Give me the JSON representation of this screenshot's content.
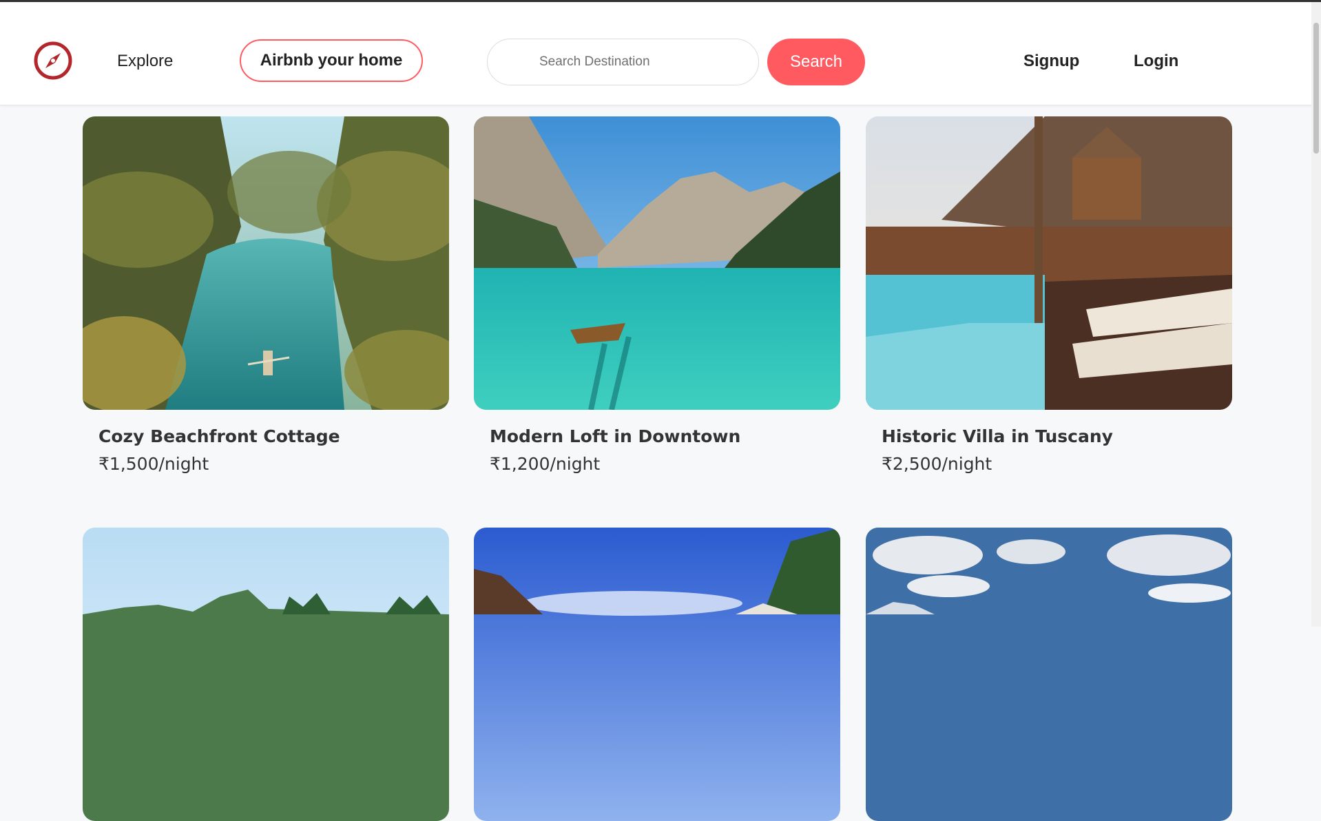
{
  "nav": {
    "explore_label": "Explore",
    "host_button_label": "Airbnb your home",
    "search_placeholder": "Search Destination",
    "search_value": "",
    "search_button_label": "Search",
    "signup_label": "Signup",
    "login_label": "Login",
    "logo_icon": "compass-icon",
    "accent_color": "#ff5a5f"
  },
  "listings": [
    {
      "title": "Cozy Beachfront Cottage",
      "price": "₹1,500/night",
      "image": "tropical-river-photo"
    },
    {
      "title": "Modern Loft in Downtown",
      "price": "₹1,200/night",
      "image": "mountain-lake-photo"
    },
    {
      "title": "Historic Villa in Tuscany",
      "price": "₹2,500/night",
      "image": "resort-pool-photo"
    },
    {
      "title": "",
      "price": "",
      "image": "tropical-island-photo"
    },
    {
      "title": "",
      "price": "",
      "image": "palm-sky-photo"
    },
    {
      "title": "",
      "price": "",
      "image": "cloudy-mountain-photo"
    }
  ]
}
